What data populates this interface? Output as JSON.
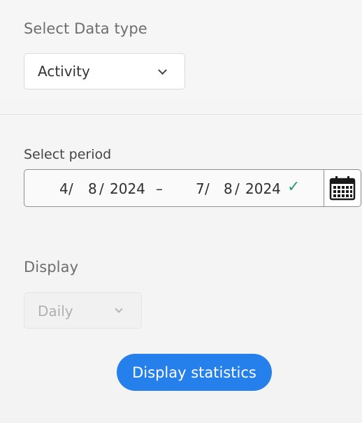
{
  "data_type": {
    "label": "Select Data type",
    "selected": "Activity"
  },
  "period": {
    "label": "Select period",
    "start": {
      "month": "4",
      "day": "8",
      "year": "2024"
    },
    "end": {
      "month": "7",
      "day": "8",
      "year": "2024"
    },
    "separator": "/",
    "range_dash": "–",
    "valid_mark": "✓"
  },
  "display": {
    "label": "Display",
    "selected": "Daily"
  },
  "actions": {
    "display_statistics": "Display statistics"
  },
  "colors": {
    "accent": "#2680eb",
    "valid": "#2d9c6c"
  }
}
